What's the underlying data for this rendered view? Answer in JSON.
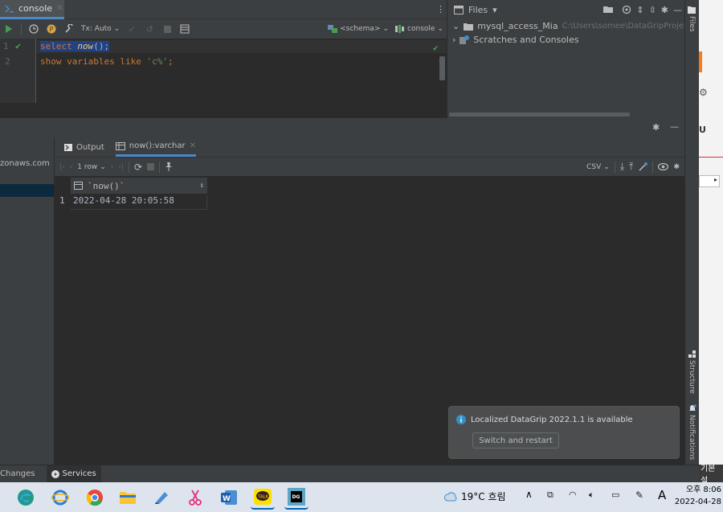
{
  "editor": {
    "tab_label": "console",
    "toolbar": {
      "tx_label": "Tx: Auto",
      "schema_label": "<schema>",
      "console_label": "console"
    },
    "lines": [
      {
        "num": "1",
        "code_part1": "select ",
        "code_fn": "now",
        "code_part2": "();"
      },
      {
        "num": "2",
        "code_kw": "show variables like ",
        "code_str": "'c%'",
        "code_end": ";"
      }
    ]
  },
  "files_panel": {
    "title": "Files",
    "root_name": "mysql_access_Mia",
    "root_path": "C:\\Users\\somee\\DataGripProjects\\",
    "scratches": "Scratches and Consoles",
    "side_tab": "Files"
  },
  "services": {
    "left_partial": "zonaws.com",
    "tabs": [
      {
        "label": "Output"
      },
      {
        "label": "now():varchar"
      }
    ],
    "rows_label": "1 row",
    "export_label": "CSV",
    "column_header": "`now()`",
    "row_number": "1",
    "cell_value": "2022-04-28 20:05:58"
  },
  "right_strip": {
    "structure": "Structure",
    "notifications": "Notifications"
  },
  "notification": {
    "message": "Localized DataGrip 2022.1.1 is available",
    "button": "Switch and restart"
  },
  "bottom_bar": {
    "changes": "Changes",
    "services": "Services",
    "right_partial": "기본 설"
  },
  "taskbar": {
    "weather": "19°C 흐림",
    "ime": "A",
    "ampm_time": "오후 8:06",
    "date": "2022-04-28"
  },
  "colors": {
    "accent": "#4a88c7",
    "keyword": "#cc7832",
    "function": "#ffc66d",
    "string": "#6a8759",
    "run_green": "#499c54"
  }
}
